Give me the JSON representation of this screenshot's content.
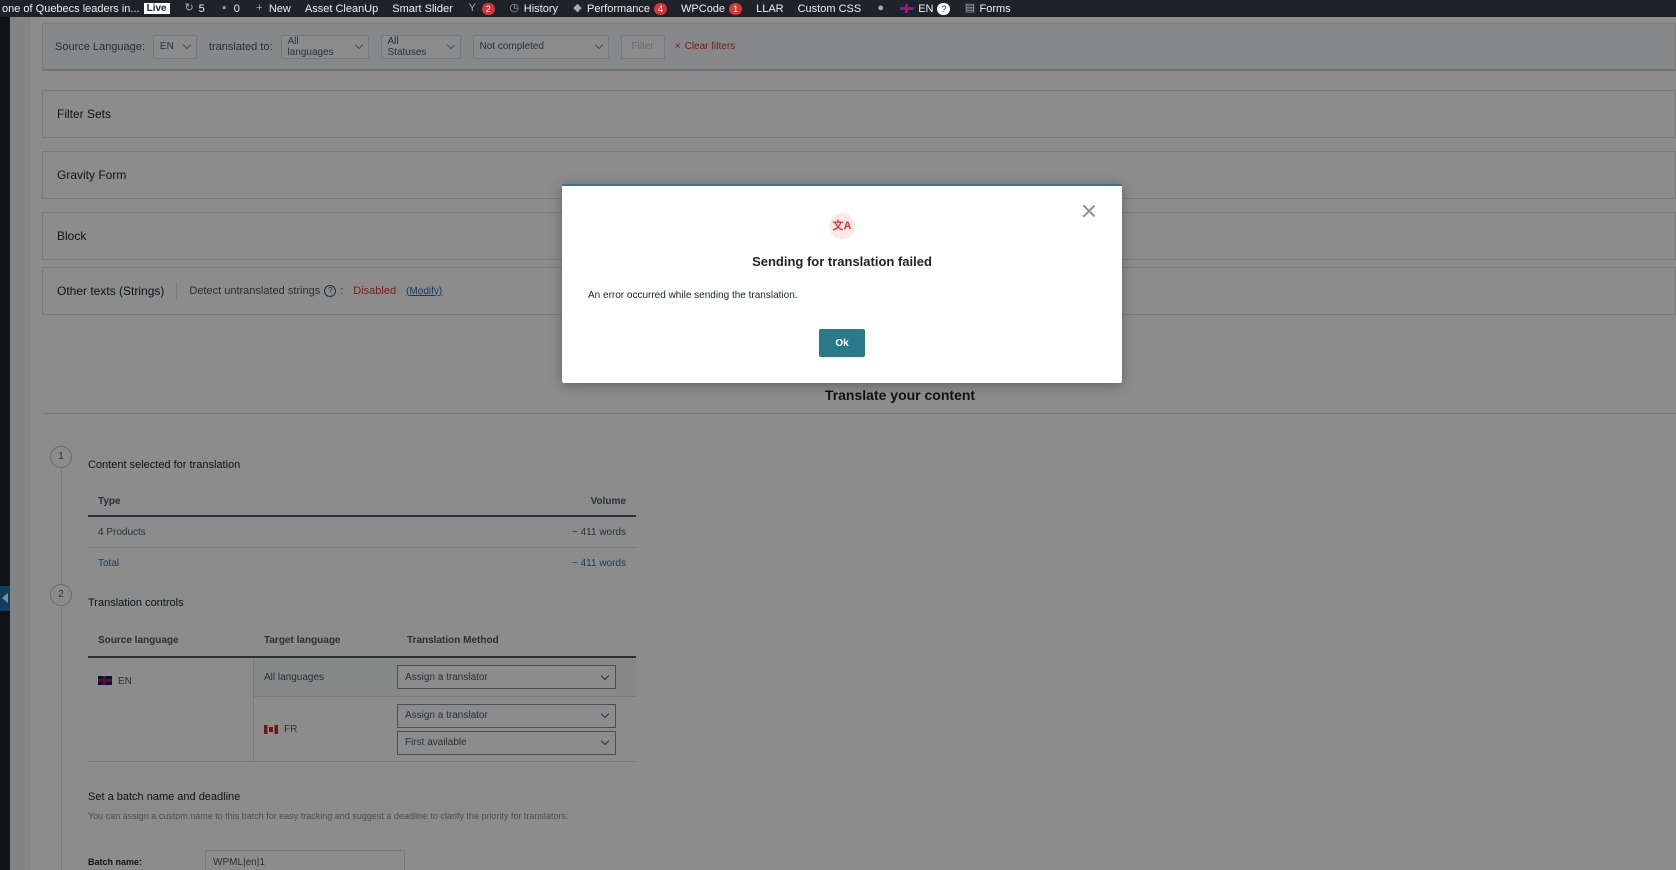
{
  "adminbar": {
    "site_title": "one of Quebecs leaders in...",
    "live_label": "Live",
    "updates_count": "5",
    "comments_count": "0",
    "new_label": "New",
    "asset_cleanup": "Asset CleanUp",
    "smart_slider": "Smart Slider",
    "yoast_badge": "2",
    "history": "History",
    "performance": "Performance",
    "performance_badge": "4",
    "wpcode": "WPCode",
    "wpcode_badge": "1",
    "llar": "LLAR",
    "custom_css": "Custom CSS",
    "lang": "EN",
    "lang_badge": "?",
    "forms": "Forms"
  },
  "filters": {
    "source_language_label": "Source Language:",
    "source_language_value": "EN",
    "translated_to_label": "translated to:",
    "translated_to_value": "All languages",
    "statuses_value": "All Statuses",
    "completion_value": "Not completed",
    "filter_button": "Filter",
    "clear_filters": "Clear filters"
  },
  "sections": {
    "filter_sets": "Filter Sets",
    "gravity_form": "Gravity Form",
    "block": "Block",
    "other_texts": "Other texts (Strings)",
    "detect_label": "Detect untranslated strings",
    "detect_status": "Disabled",
    "modify": "(Modify)"
  },
  "translate": {
    "title": "Translate your content",
    "step1_number": "1",
    "step1_title": "Content selected for translation",
    "volume_table": {
      "col_type": "Type",
      "col_volume": "Volume",
      "rows": [
        {
          "type": "4 Products",
          "volume": "~ 411 words"
        }
      ],
      "total_label": "Total",
      "total_value": "~ 411 words"
    },
    "step2_number": "2",
    "step2_title": "Translation controls",
    "controls_table": {
      "col_source": "Source language",
      "col_target": "Target language",
      "col_method": "Translation Method",
      "source_lang": "EN",
      "all_languages": "All languages",
      "all_method": "Assign a translator",
      "fr_lang": "FR",
      "fr_method": "Assign a translator",
      "fr_translator": "First available"
    },
    "batch": {
      "title": "Set a batch name and deadline",
      "description": "You can assign a custom name to this batch for easy tracking and suggest a deadline to clarify the priority for translators.",
      "name_label": "Batch name:",
      "name_value": "WPML|en|1"
    }
  },
  "modal": {
    "icon": "translate-icon",
    "icon_glyph": "文A",
    "title": "Sending for translation failed",
    "message": "An error occurred while sending the translation.",
    "ok_label": "Ok"
  }
}
